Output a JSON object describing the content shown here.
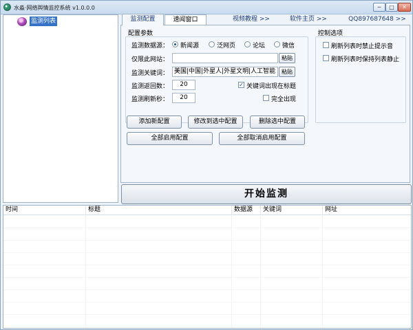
{
  "window": {
    "title": "水淼·网络舆情监控系统 v1.0.0.0",
    "min_label": "─",
    "max_label": "□",
    "close_label": "✕"
  },
  "tree": {
    "root_label": "监测列表"
  },
  "tabs": [
    {
      "label": "监测配置",
      "active": true
    },
    {
      "label": "速闻窗口",
      "active": false
    },
    {
      "label": "视频教程 >>",
      "active": false
    },
    {
      "label": "软件主页 >>",
      "active": false
    },
    {
      "label": "QQ897687648 >>",
      "active": false
    }
  ],
  "config": {
    "group_label": "配置参数",
    "source_label": "监测数据源：",
    "sources": [
      {
        "label": "新闻源",
        "checked": true
      },
      {
        "label": "泛网页",
        "checked": false
      },
      {
        "label": "论坛",
        "checked": false
      },
      {
        "label": "微信",
        "checked": false
      }
    ],
    "site_label": "仅限此网站：",
    "site_value": "",
    "paste_label": "粘贴",
    "keyword_label": "监测关键词：",
    "keyword_value": "美国|中国|外星人|外星文明|人工智能",
    "pages_label": "监测返回数：",
    "pages_value": "20",
    "refresh_label": "监测刷新秒：",
    "refresh_value": "20",
    "title_match_label": "关键词出现在标题",
    "title_match_checked": true,
    "full_match_label": "完全出现",
    "full_match_checked": false
  },
  "control": {
    "group_label": "控制选项",
    "opt1_label": "刷新列表时禁止提示音",
    "opt1_checked": false,
    "opt2_label": "刷新列表时保持列表静止",
    "opt2_checked": false
  },
  "buttons": {
    "add": "添加新配置",
    "modify": "修改到选中配置",
    "delete": "删除选中配置",
    "enable_all": "全部启用配置",
    "disable_all": "全部取消启用配置",
    "start": "开始监测"
  },
  "list": {
    "columns": [
      "时间",
      "标题",
      "数据源",
      "关键词",
      "网址"
    ],
    "rows": []
  }
}
